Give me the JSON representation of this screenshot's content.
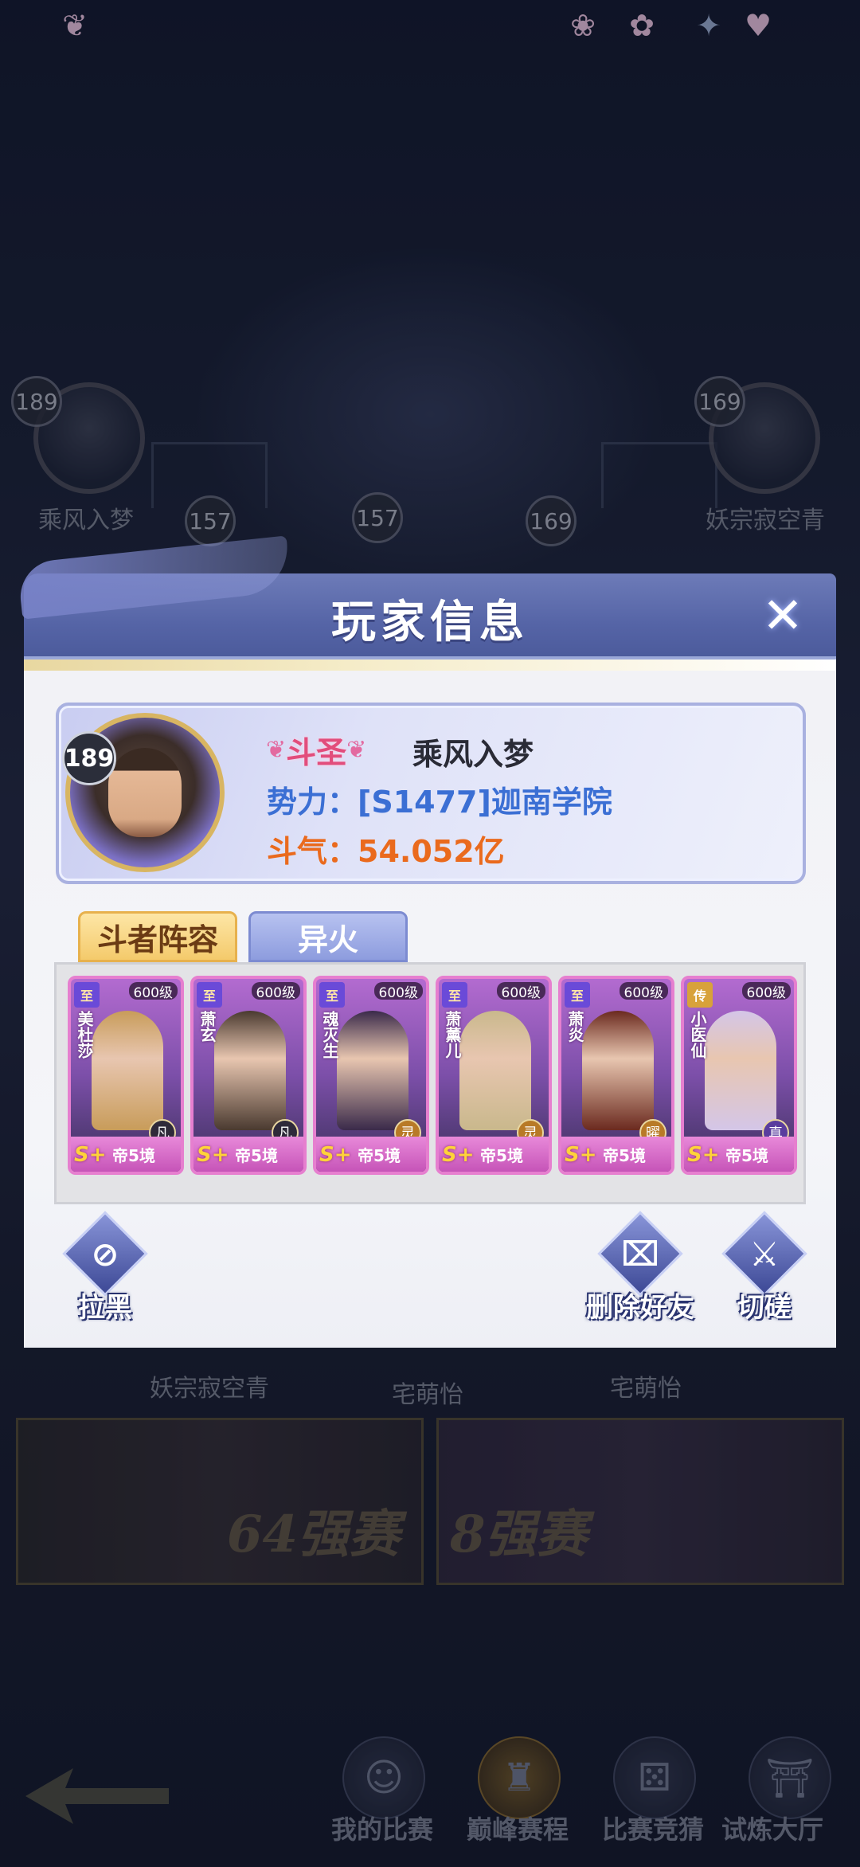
{
  "background": {
    "bracket_names": [
      "乘风入梦",
      "妖宗寂空青",
      "妖宗寂空青",
      "宅萌怡",
      "宅萌怡"
    ],
    "bracket_levels": [
      "189",
      "169",
      "157",
      "157",
      "169"
    ],
    "banners": [
      "64强赛",
      "8强赛"
    ],
    "bottom_nav": [
      {
        "label": "我的比赛",
        "icon": "portrait-icon"
      },
      {
        "label": "巅峰赛程",
        "icon": "castle-icon"
      },
      {
        "label": "比赛竞猜",
        "icon": "dice-icon"
      },
      {
        "label": "试炼大厅",
        "icon": "pagoda-icon"
      }
    ]
  },
  "dialog": {
    "title": "玩家信息",
    "close_icon": "close-icon",
    "player": {
      "level": "189",
      "rank": "斗圣",
      "name": "乘风入梦",
      "faction": "势力：[S1477]迦南学院",
      "power": "斗气：54.052亿"
    },
    "tabs": [
      {
        "label": "斗者阵容",
        "active": true
      },
      {
        "label": "异火",
        "active": false
      }
    ],
    "heroes": [
      {
        "tier": "至",
        "level": "600级",
        "name": "美杜莎",
        "grade": "凡",
        "star": "帝5境",
        "color": "#c89c5a"
      },
      {
        "tier": "至",
        "level": "600级",
        "name": "萧玄",
        "grade": "凡",
        "star": "帝5境",
        "color": "#4a3a30"
      },
      {
        "tier": "至",
        "level": "600级",
        "name": "魂灭生",
        "grade": "灵",
        "star": "帝5境",
        "color": "#3a2a4a"
      },
      {
        "tier": "至",
        "level": "600级",
        "name": "萧薰儿",
        "grade": "灵",
        "star": "帝5境",
        "color": "#c9b88c"
      },
      {
        "tier": "至",
        "level": "600级",
        "name": "萧炎",
        "grade": "曜",
        "star": "帝5境",
        "color": "#6b2a1f"
      },
      {
        "tier": "传",
        "level": "600级",
        "name": "小医仙",
        "grade": "真",
        "star": "帝5境",
        "color": "#d4c6e8"
      }
    ],
    "actions": [
      {
        "label": "拉黑",
        "icon": "block-icon"
      },
      {
        "label": "删除好友",
        "icon": "trash-icon"
      },
      {
        "label": "切磋",
        "icon": "swords-icon"
      }
    ]
  }
}
